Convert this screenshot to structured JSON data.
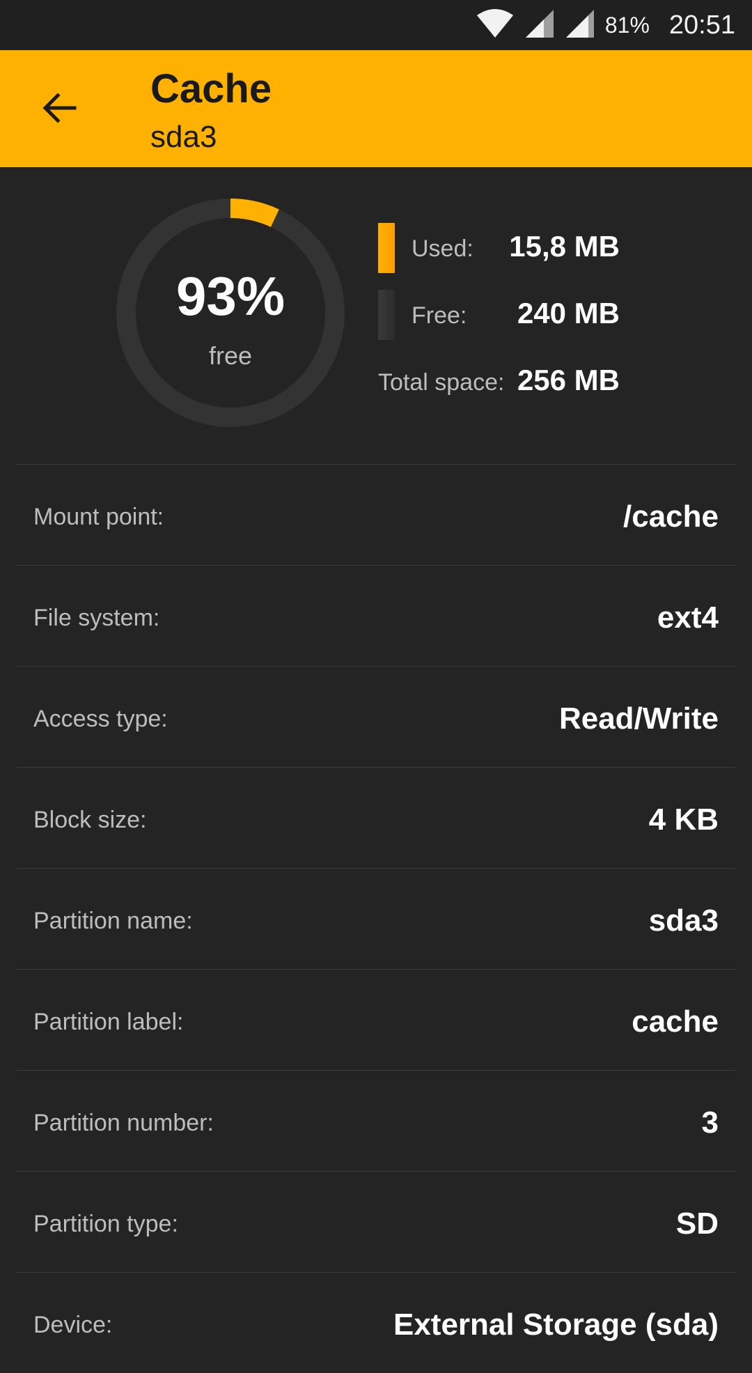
{
  "status_bar": {
    "battery": "81%",
    "time": "20:51"
  },
  "app_bar": {
    "title": "Cache",
    "subtitle": "sda3"
  },
  "summary": {
    "free_percent": "93%",
    "free_label": "free",
    "used_fraction": 0.07,
    "legend": [
      {
        "label": "Used:",
        "value": "15,8 MB",
        "color": "#ffb100"
      },
      {
        "label": "Free:",
        "value": "240 MB",
        "color": "#3a3a3a"
      },
      {
        "label": "Total space:",
        "value": "256 MB"
      }
    ]
  },
  "details": [
    {
      "label": "Mount point:",
      "value": "/cache"
    },
    {
      "label": "File system:",
      "value": "ext4"
    },
    {
      "label": "Access type:",
      "value": "Read/Write"
    },
    {
      "label": "Block size:",
      "value": "4 KB"
    },
    {
      "label": "Partition name:",
      "value": "sda3"
    },
    {
      "label": "Partition label:",
      "value": "cache"
    },
    {
      "label": "Partition number:",
      "value": "3"
    },
    {
      "label": "Partition type:",
      "value": "SD"
    },
    {
      "label": "Device:",
      "value": "External Storage (sda)"
    }
  ],
  "colors": {
    "accent": "#ffb100",
    "background": "#242424",
    "ring_track": "#333333"
  }
}
